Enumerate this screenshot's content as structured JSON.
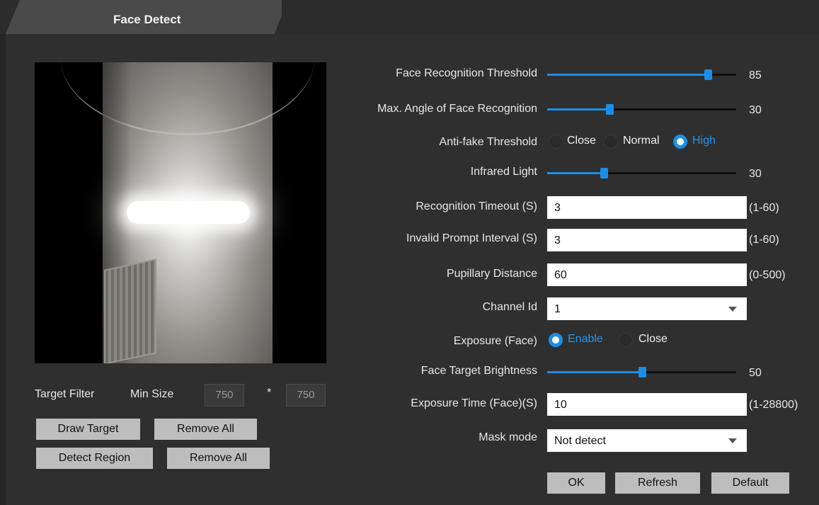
{
  "tab": {
    "title": "Face Detect"
  },
  "filter": {
    "target_filter_label": "Target Filter",
    "min_size_label": "Min Size",
    "width": "750",
    "separator": "*",
    "height": "750",
    "draw_target": "Draw Target",
    "remove_all_1": "Remove All",
    "detect_region": "Detect Region",
    "remove_all_2": "Remove All"
  },
  "settings": {
    "face_recognition_threshold": {
      "label": "Face Recognition Threshold",
      "value": "85",
      "level": 0.85
    },
    "max_angle": {
      "label": "Max. Angle of Face Recognition",
      "value": "30",
      "level": 0.33
    },
    "anti_fake": {
      "label": "Anti-fake Threshold",
      "options": [
        "Close",
        "Normal",
        "High"
      ],
      "selected": "High"
    },
    "infrared_light": {
      "label": "Infrared Light",
      "value": "30",
      "level": 0.3
    },
    "recognition_timeout": {
      "label": "Recognition Timeout (S)",
      "value": "3",
      "range": "(1-60)"
    },
    "invalid_prompt_interval": {
      "label": "Invalid Prompt Interval (S)",
      "value": "3",
      "range": "(1-60)"
    },
    "pupillary_distance": {
      "label": "Pupillary Distance",
      "value": "60",
      "range": "(0-500)"
    },
    "channel_id": {
      "label": "Channel Id",
      "value": "1"
    },
    "exposure_face": {
      "label": "Exposure (Face)",
      "options": [
        "Enable",
        "Close"
      ],
      "selected": "Enable"
    },
    "face_target_brightness": {
      "label": "Face Target Brightness",
      "value": "50",
      "level": 0.5
    },
    "exposure_time": {
      "label": "Exposure Time (Face)(S)",
      "value": "10",
      "range": "(1-28800)"
    },
    "mask_mode": {
      "label": "Mask mode",
      "value": "Not detect"
    }
  },
  "buttons": {
    "ok": "OK",
    "refresh": "Refresh",
    "default": "Default"
  },
  "colors": {
    "accent": "#1a8ee6",
    "panel_bg": "#2f2f2f",
    "button_bg": "#bdbdbd"
  }
}
